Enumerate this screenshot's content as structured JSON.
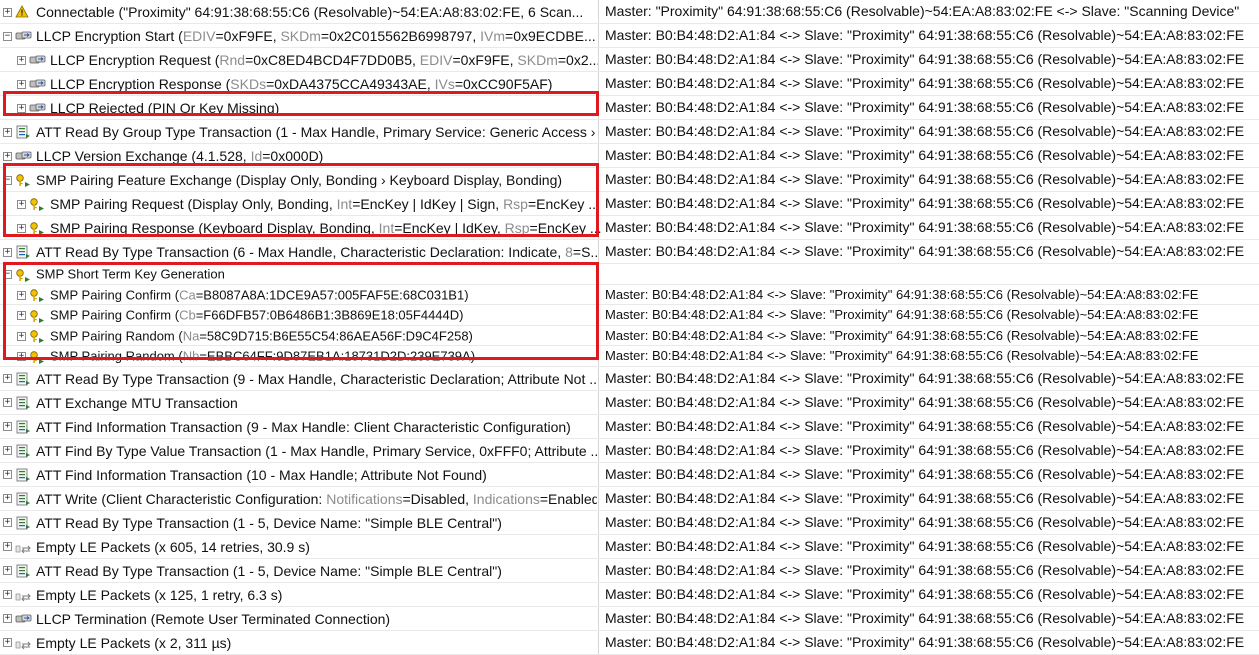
{
  "rows": [
    {
      "level": 0,
      "expander": "⊞",
      "icon": "warning-key-icon",
      "text": [
        {
          "t": "Connectable (\"Proximity\" 64:91:38:68:55:C6 (Resolvable)~54:EA:A8:83:02:FE, 6 Scan..."
        }
      ],
      "right": "Master: \"Proximity\" 64:91:38:68:55:C6 (Resolvable)~54:EA:A8:83:02:FE <-> Slave: \"Scanning Device\""
    },
    {
      "level": 0,
      "expander": "⊟",
      "icon": "llcp-icon",
      "text": [
        {
          "t": "LLCP Encryption Start ("
        },
        {
          "k": "EDIV"
        },
        {
          "t": "=0xF9FE, "
        },
        {
          "k": "SKDm"
        },
        {
          "t": "=0x2C015562B6998797, "
        },
        {
          "k": "IVm"
        },
        {
          "t": "=0x9ECDBE..."
        }
      ],
      "right": "Master: B0:B4:48:D2:A1:84 <-> Slave: \"Proximity\" 64:91:38:68:55:C6 (Resolvable)~54:EA:A8:83:02:FE"
    },
    {
      "level": 1,
      "expander": "⊞",
      "icon": "llcp-icon",
      "text": [
        {
          "t": "LLCP Encryption Request ("
        },
        {
          "k": "Rnd"
        },
        {
          "t": "=0xC8ED4BCD4F7DD0B5, "
        },
        {
          "k": "EDIV"
        },
        {
          "t": "=0xF9FE, "
        },
        {
          "k": "SKDm"
        },
        {
          "t": "=0x2..."
        }
      ],
      "right": "Master: B0:B4:48:D2:A1:84 <-> Slave: \"Proximity\" 64:91:38:68:55:C6 (Resolvable)~54:EA:A8:83:02:FE"
    },
    {
      "level": 1,
      "expander": "⊞",
      "icon": "llcp-icon",
      "text": [
        {
          "t": "LLCP Encryption Response ("
        },
        {
          "k": "SKDs"
        },
        {
          "t": "=0xDA4375CCA49343AE, "
        },
        {
          "k": "IVs"
        },
        {
          "t": "=0xCC90F5AF)"
        }
      ],
      "right": "Master: B0:B4:48:D2:A1:84 <-> Slave: \"Proximity\" 64:91:38:68:55:C6 (Resolvable)~54:EA:A8:83:02:FE"
    },
    {
      "level": 1,
      "expander": "⊞",
      "icon": "llcp-icon",
      "text": [
        {
          "t": "LLCP Rejected (PIN Or Key Missing)"
        }
      ],
      "right": "Master: B0:B4:48:D2:A1:84 <-> Slave: \"Proximity\" 64:91:38:68:55:C6 (Resolvable)~54:EA:A8:83:02:FE"
    },
    {
      "level": 0,
      "expander": "⊞",
      "icon": "att-icon",
      "text": [
        {
          "t": "ATT Read By Group Type Transaction (1 - Max Handle, Primary Service:  Generic Access › ..."
        }
      ],
      "right": "Master: B0:B4:48:D2:A1:84 <-> Slave: \"Proximity\" 64:91:38:68:55:C6 (Resolvable)~54:EA:A8:83:02:FE"
    },
    {
      "level": 0,
      "expander": "⊞",
      "icon": "llcp-icon",
      "text": [
        {
          "t": "LLCP Version Exchange (4.1.528, "
        },
        {
          "k": "Id"
        },
        {
          "t": "=0x000D)"
        }
      ],
      "right": "Master: B0:B4:48:D2:A1:84 <-> Slave: \"Proximity\" 64:91:38:68:55:C6 (Resolvable)~54:EA:A8:83:02:FE"
    },
    {
      "level": 0,
      "expander": "⊟",
      "icon": "smp-key-icon",
      "text": [
        {
          "t": "SMP Pairing Feature Exchange (Display Only, Bonding › Keyboard Display, Bonding)"
        }
      ],
      "right": "Master: B0:B4:48:D2:A1:84 <-> Slave: \"Proximity\" 64:91:38:68:55:C6 (Resolvable)~54:EA:A8:83:02:FE"
    },
    {
      "level": 1,
      "expander": "⊞",
      "icon": "smp-key-icon",
      "text": [
        {
          "t": "SMP Pairing Request (Display Only, Bonding, "
        },
        {
          "k": "Int"
        },
        {
          "t": "=EncKey | IdKey | Sign, "
        },
        {
          "k": "Rsp"
        },
        {
          "t": "=EncKey ..."
        }
      ],
      "right": "Master: B0:B4:48:D2:A1:84 <-> Slave: \"Proximity\" 64:91:38:68:55:C6 (Resolvable)~54:EA:A8:83:02:FE"
    },
    {
      "level": 1,
      "expander": "⊞",
      "icon": "smp-key-icon",
      "text": [
        {
          "t": "SMP Pairing Response (Keyboard Display, Bonding, "
        },
        {
          "k": "Int"
        },
        {
          "t": "=EncKey | IdKey, "
        },
        {
          "k": "Rsp"
        },
        {
          "t": "=EncKey ..."
        }
      ],
      "right": "Master: B0:B4:48:D2:A1:84 <-> Slave: \"Proximity\" 64:91:38:68:55:C6 (Resolvable)~54:EA:A8:83:02:FE"
    },
    {
      "level": 0,
      "expander": "⊞",
      "icon": "att-icon",
      "text": [
        {
          "t": "ATT Read By Type Transaction (6 - Max Handle, Characteristic Declaration: Indicate, "
        },
        {
          "k": "8"
        },
        {
          "t": "=S..."
        }
      ],
      "right": "Master: B0:B4:48:D2:A1:84 <-> Slave: \"Proximity\" 64:91:38:68:55:C6 (Resolvable)~54:EA:A8:83:02:FE"
    },
    {
      "level": 0,
      "expander": "⊟",
      "icon": "smp-key-icon",
      "compact": true,
      "text": [
        {
          "t": "SMP Short Term Key Generation"
        }
      ],
      "right": ""
    },
    {
      "level": 1,
      "expander": "⊞",
      "icon": "smp-key-icon",
      "compact": true,
      "text": [
        {
          "t": "SMP Pairing Confirm ("
        },
        {
          "k": "Ca"
        },
        {
          "t": "=B8087A8A:1DCE9A57:005FAF5E:68C031B1)"
        }
      ],
      "right": "Master: B0:B4:48:D2:A1:84 <-> Slave: \"Proximity\" 64:91:38:68:55:C6 (Resolvable)~54:EA:A8:83:02:FE"
    },
    {
      "level": 1,
      "expander": "⊞",
      "icon": "smp-key-icon",
      "compact": true,
      "text": [
        {
          "t": "SMP Pairing Confirm ("
        },
        {
          "k": "Cb"
        },
        {
          "t": "=F66DFB57:0B6486B1:3B869E18:05F4444D)"
        }
      ],
      "right": "Master: B0:B4:48:D2:A1:84 <-> Slave: \"Proximity\" 64:91:38:68:55:C6 (Resolvable)~54:EA:A8:83:02:FE"
    },
    {
      "level": 1,
      "expander": "⊞",
      "icon": "smp-key-icon",
      "compact": true,
      "text": [
        {
          "t": "SMP Pairing Random ("
        },
        {
          "k": "Na"
        },
        {
          "t": "=58C9D715:B6E55C54:86AEA56F:D9C4F258)"
        }
      ],
      "right": "Master: B0:B4:48:D2:A1:84 <-> Slave: \"Proximity\" 64:91:38:68:55:C6 (Resolvable)~54:EA:A8:83:02:FE"
    },
    {
      "level": 1,
      "expander": "⊞",
      "icon": "smp-key-icon",
      "compact": true,
      "text": [
        {
          "t": "SMP Pairing Random ("
        },
        {
          "k": "Nb"
        },
        {
          "t": "=EBBC64FF:9D87EB1A:18731D2D:239E739A)"
        }
      ],
      "right": "Master: B0:B4:48:D2:A1:84 <-> Slave: \"Proximity\" 64:91:38:68:55:C6 (Resolvable)~54:EA:A8:83:02:FE"
    },
    {
      "level": 0,
      "expander": "⊞",
      "icon": "att-icon",
      "text": [
        {
          "t": "ATT Read By Type Transaction (9 - Max Handle, Characteristic Declaration; Attribute Not ..."
        }
      ],
      "right": "Master: B0:B4:48:D2:A1:84 <-> Slave: \"Proximity\" 64:91:38:68:55:C6 (Resolvable)~54:EA:A8:83:02:FE"
    },
    {
      "level": 0,
      "expander": "⊞",
      "icon": "att-icon",
      "text": [
        {
          "t": "ATT Exchange MTU Transaction"
        }
      ],
      "right": "Master: B0:B4:48:D2:A1:84 <-> Slave: \"Proximity\" 64:91:38:68:55:C6 (Resolvable)~54:EA:A8:83:02:FE"
    },
    {
      "level": 0,
      "expander": "⊞",
      "icon": "att-icon",
      "text": [
        {
          "t": "ATT Find Information Transaction (9 - Max Handle: Client Characteristic Configuration)"
        }
      ],
      "right": "Master: B0:B4:48:D2:A1:84 <-> Slave: \"Proximity\" 64:91:38:68:55:C6 (Resolvable)~54:EA:A8:83:02:FE"
    },
    {
      "level": 0,
      "expander": "⊞",
      "icon": "att-icon",
      "text": [
        {
          "t": "ATT Find By Type Value Transaction (1 - Max Handle, Primary Service, 0xFFF0; Attribute ..."
        }
      ],
      "right": "Master: B0:B4:48:D2:A1:84 <-> Slave: \"Proximity\" 64:91:38:68:55:C6 (Resolvable)~54:EA:A8:83:02:FE"
    },
    {
      "level": 0,
      "expander": "⊞",
      "icon": "att-icon",
      "text": [
        {
          "t": "ATT Find Information Transaction (10 - Max Handle; Attribute Not Found)"
        }
      ],
      "right": "Master: B0:B4:48:D2:A1:84 <-> Slave: \"Proximity\" 64:91:38:68:55:C6 (Resolvable)~54:EA:A8:83:02:FE"
    },
    {
      "level": 0,
      "expander": "⊞",
      "icon": "att-icon",
      "text": [
        {
          "t": "ATT Write (Client Characteristic Configuration: "
        },
        {
          "k": "Notifications"
        },
        {
          "t": "=Disabled, "
        },
        {
          "k": "Indications"
        },
        {
          "t": "=Enabled)"
        }
      ],
      "right": "Master: B0:B4:48:D2:A1:84 <-> Slave: \"Proximity\" 64:91:38:68:55:C6 (Resolvable)~54:EA:A8:83:02:FE"
    },
    {
      "level": 0,
      "expander": "⊞",
      "icon": "att-icon",
      "text": [
        {
          "t": "ATT Read By Type Transaction (1 - 5, Device Name: \"Simple BLE Central\")"
        }
      ],
      "right": "Master: B0:B4:48:D2:A1:84 <-> Slave: \"Proximity\" 64:91:38:68:55:C6 (Resolvable)~54:EA:A8:83:02:FE"
    },
    {
      "level": 0,
      "expander": "⊞",
      "icon": "empty-packets-icon",
      "text": [
        {
          "t": "Empty LE Packets (x 605, 14 retries, 30.9 s)"
        }
      ],
      "right": "Master: B0:B4:48:D2:A1:84 <-> Slave: \"Proximity\" 64:91:38:68:55:C6 (Resolvable)~54:EA:A8:83:02:FE"
    },
    {
      "level": 0,
      "expander": "⊞",
      "icon": "att-icon",
      "text": [
        {
          "t": "ATT Read By Type Transaction (1 - 5, Device Name: \"Simple BLE Central\")"
        }
      ],
      "right": "Master: B0:B4:48:D2:A1:84 <-> Slave: \"Proximity\" 64:91:38:68:55:C6 (Resolvable)~54:EA:A8:83:02:FE"
    },
    {
      "level": 0,
      "expander": "⊞",
      "icon": "empty-packets-icon",
      "text": [
        {
          "t": "Empty LE Packets (x 125, 1 retry, 6.3 s)"
        }
      ],
      "right": "Master: B0:B4:48:D2:A1:84 <-> Slave: \"Proximity\" 64:91:38:68:55:C6 (Resolvable)~54:EA:A8:83:02:FE"
    },
    {
      "level": 0,
      "expander": "⊞",
      "icon": "llcp-icon",
      "text": [
        {
          "t": "LLCP Termination (Remote User Terminated Connection)"
        }
      ],
      "right": "Master: B0:B4:48:D2:A1:84 <-> Slave: \"Proximity\" 64:91:38:68:55:C6 (Resolvable)~54:EA:A8:83:02:FE"
    },
    {
      "level": 0,
      "expander": "⊞",
      "icon": "empty-packets-icon",
      "text": [
        {
          "t": "Empty LE Packets (x 2, 311 µs)"
        }
      ],
      "right": "Master: B0:B4:48:D2:A1:84 <-> Slave: \"Proximity\" 64:91:38:68:55:C6 (Resolvable)~54:EA:A8:83:02:FE"
    }
  ],
  "colors": {
    "highlight": "#e0191f",
    "key_gray": "#8c8c8c",
    "grid_line": "#e9e9e9",
    "column_divider": "#d6d6d6"
  }
}
